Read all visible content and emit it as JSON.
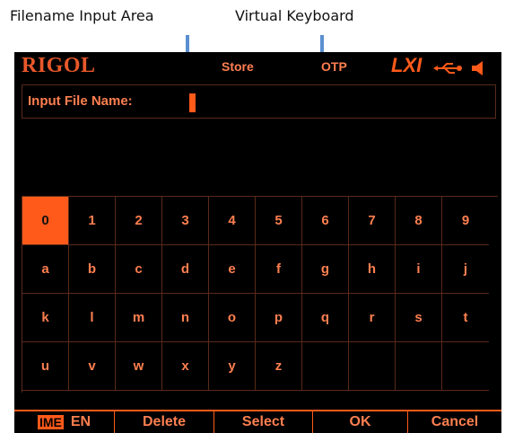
{
  "callouts": {
    "filename_input_area": "Filename Input Area",
    "virtual_keyboard": "Virtual Keyboard"
  },
  "statusbar": {
    "logo": "RIGOL",
    "mode": "Store",
    "otp": "OTP",
    "lxi": "LXI",
    "usb_icon": "usb-icon",
    "speaker_icon": "speaker-icon"
  },
  "input": {
    "label": "Input File Name:",
    "value": ""
  },
  "keyboard": {
    "rows": [
      [
        "0",
        "1",
        "2",
        "3",
        "4",
        "5",
        "6",
        "7",
        "8",
        "9"
      ],
      [
        "a",
        "b",
        "c",
        "d",
        "e",
        "f",
        "g",
        "h",
        "i",
        "j"
      ],
      [
        "k",
        "l",
        "m",
        "n",
        "o",
        "p",
        "q",
        "r",
        "s",
        "t"
      ],
      [
        "u",
        "v",
        "w",
        "x",
        "y",
        "z",
        "",
        "",
        "",
        ""
      ]
    ],
    "selected": "0"
  },
  "menubar": {
    "ime_tag": "IME",
    "ime_value": "EN",
    "delete": "Delete",
    "select": "Select",
    "ok": "OK",
    "cancel": "Cancel"
  },
  "colors": {
    "accent": "#ff5a1a",
    "text": "#ff7f50",
    "grid": "#5a2a18",
    "callout_arrow": "#5b8fd0"
  }
}
